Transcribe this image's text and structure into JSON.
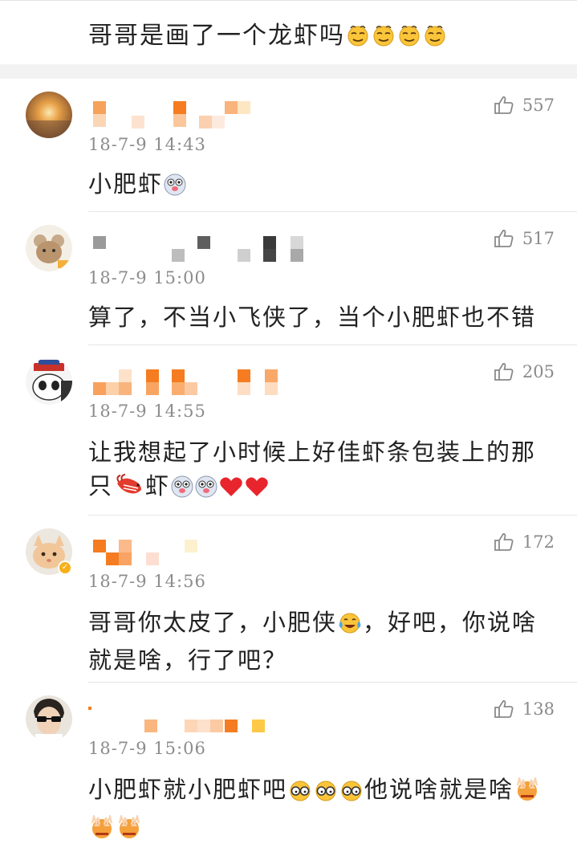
{
  "post": {
    "text": "哥哥是画了一个龙虾吗",
    "emoji_count": 4
  },
  "comments": [
    {
      "likes": "557",
      "time": "18-7-9  14:43",
      "text": "小肥虾"
    },
    {
      "likes": "517",
      "time": "18-7-9  15:00",
      "text": "算了，不当小飞侠了，当个小肥虾也不错"
    },
    {
      "likes": "205",
      "time": "18-7-9  14:55",
      "text_line1": "让我想起了小时候上好佳虾条包装上的那",
      "text_line2_a": "只",
      "text_line2_b": "虾"
    },
    {
      "likes": "172",
      "time": "18-7-9  14:56",
      "text_line1_a": "哥哥你太皮了，小肥侠",
      "text_line1_b": "，好吧，你说啥",
      "text_line2": "就是啥，行了吧？"
    },
    {
      "likes": "138",
      "time": "18-7-9  15:06",
      "text_a": "小肥虾就小肥虾吧",
      "text_b": "他说啥就是啥"
    }
  ],
  "colors": {
    "accent_orange": "#f57c20",
    "muted_gray": "#8c8c8c",
    "separator": "#f2f2f2",
    "heart_red": "#e8252c",
    "verified_badge": "#f8b019"
  },
  "icons": [
    "thumbs-up-icon",
    "smirk-emoji",
    "dog-face-emoji",
    "lobster-emoji",
    "red-heart-emoji",
    "laugh-cry-emoji",
    "eyeglasses-emoji",
    "hands-over-face-emoji"
  ]
}
